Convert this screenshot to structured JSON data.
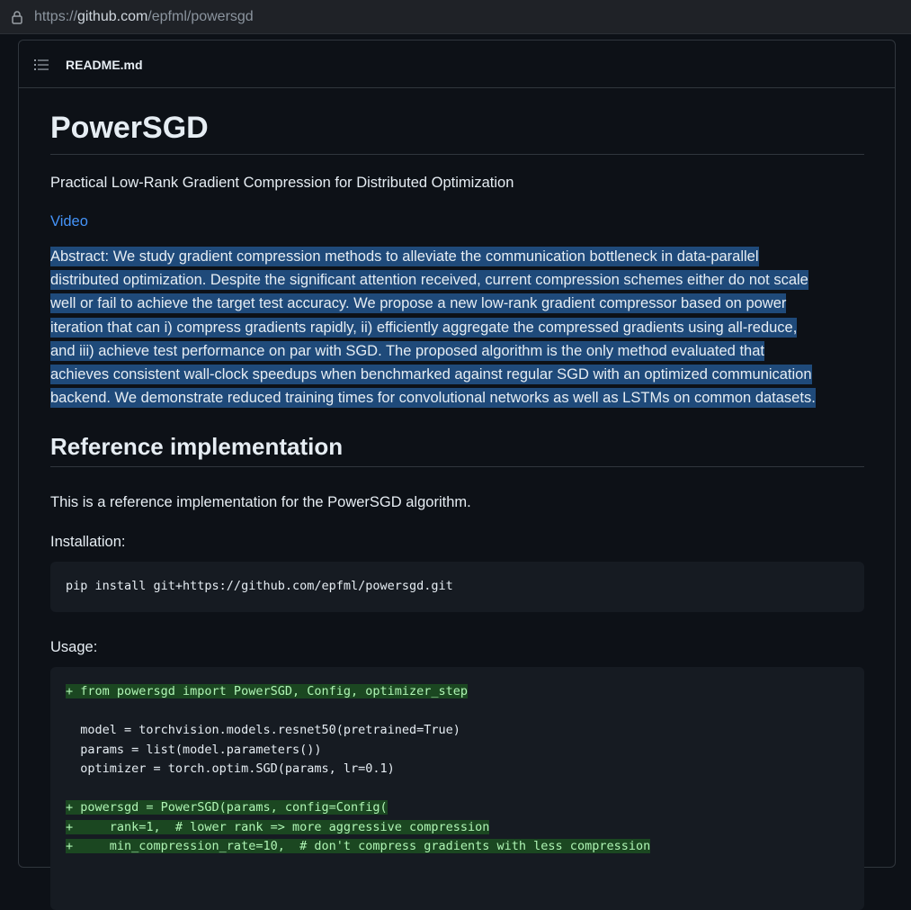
{
  "browser": {
    "url_scheme": "https://",
    "url_host": "github.com",
    "url_path": "/epfml/powersgd"
  },
  "file_header": {
    "filename": "README.md"
  },
  "readme": {
    "title": "PowerSGD",
    "subtitle": "Practical Low-Rank Gradient Compression for Distributed Optimization",
    "video_link": "Video",
    "abstract_lines": [
      "Abstract: We study gradient compression methods to alleviate the communication bottleneck in data-parallel",
      "distributed optimization. Despite the significant attention received, current compression schemes either do not scale",
      "well or fail to achieve the target test accuracy. We propose a new low-rank gradient compressor based on power",
      "iteration that can i) compress gradients rapidly, ii) efficiently aggregate the compressed gradients using all-reduce,",
      "and iii) achieve test performance on par with SGD. The proposed algorithm is the only method evaluated that",
      "achieves consistent wall-clock speedups when benchmarked against regular SGD with an optimized communication",
      "backend. We demonstrate reduced training times for convolutional networks as well as LSTMs on common datasets."
    ],
    "section_heading": "Reference implementation",
    "reference_text": "This is a reference implementation for the PowerSGD algorithm.",
    "installation_label": "Installation:",
    "install_command": "pip install git+https://github.com/epfml/powersgd.git",
    "usage_label": "Usage:",
    "usage_code": [
      {
        "text": "+ from powersgd import PowerSGD, Config, optimizer_step",
        "added": true
      },
      {
        "text": "",
        "added": false
      },
      {
        "text": "  model = torchvision.models.resnet50(pretrained=True)",
        "added": false
      },
      {
        "text": "  params = list(model.parameters())",
        "added": false
      },
      {
        "text": "  optimizer = torch.optim.SGD(params, lr=0.1)",
        "added": false
      },
      {
        "text": "",
        "added": false
      },
      {
        "text": "+ powersgd = PowerSGD(params, config=Config(",
        "added": true
      },
      {
        "text": "+     rank=1,  # lower rank => more aggressive compression",
        "added": true
      },
      {
        "text": "+     min_compression_rate=10,  # don't compress gradients with less compression",
        "added": true
      }
    ]
  },
  "colors": {
    "background": "#0d1117",
    "link": "#4493f8",
    "selection": "#1f4a7a",
    "diff_added": "#1b4721"
  }
}
